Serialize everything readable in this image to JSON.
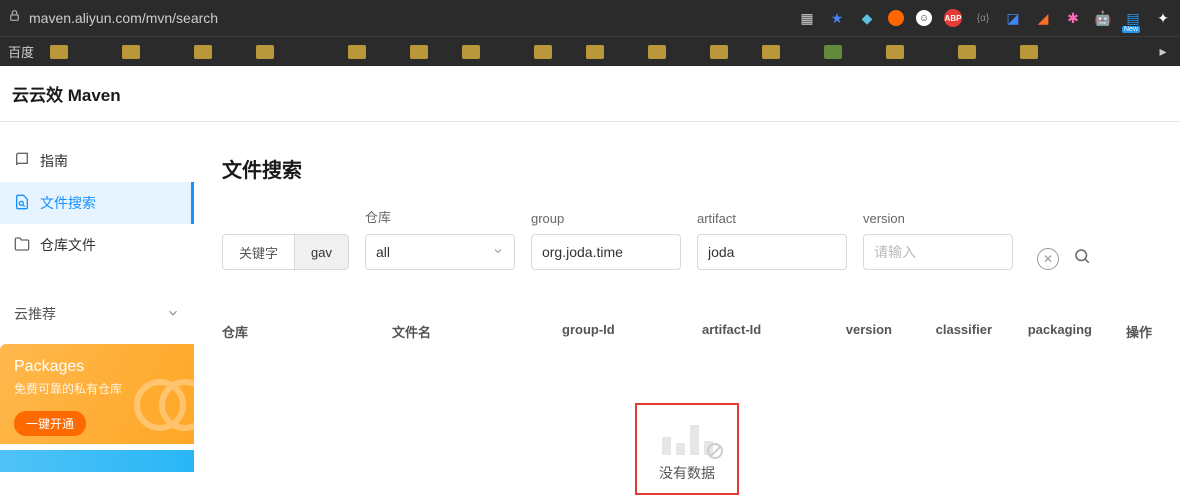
{
  "browser": {
    "url": "maven.aliyun.com/mvn/search",
    "bookmarks": {
      "first_label": "百度"
    }
  },
  "page": {
    "title": "云云效 Maven"
  },
  "sidebar": {
    "items": [
      {
        "icon": "book",
        "label": "指南"
      },
      {
        "icon": "search",
        "label": "文件搜索"
      },
      {
        "icon": "folder",
        "label": "仓库文件"
      }
    ],
    "section_label": "云推荐",
    "promo": {
      "title": "Packages",
      "subtitle": "免费可靠的私有仓库",
      "button": "一键开通"
    }
  },
  "main": {
    "section_title": "文件搜索",
    "toggle": {
      "keyword": "关键字",
      "gav": "gav"
    },
    "fields": {
      "repo_label": "仓库",
      "repo_value": "all",
      "group_label": "group",
      "group_value": "org.joda.time",
      "artifact_label": "artifact",
      "artifact_value": "joda",
      "version_label": "version",
      "version_placeholder": "请输入"
    },
    "table": {
      "headers": {
        "repo": "仓库",
        "file": "文件名",
        "group": "group-Id",
        "artifact": "artifact-Id",
        "version": "version",
        "classifier": "classifier",
        "packaging": "packaging",
        "action": "操作"
      },
      "empty_text": "没有数据"
    }
  }
}
